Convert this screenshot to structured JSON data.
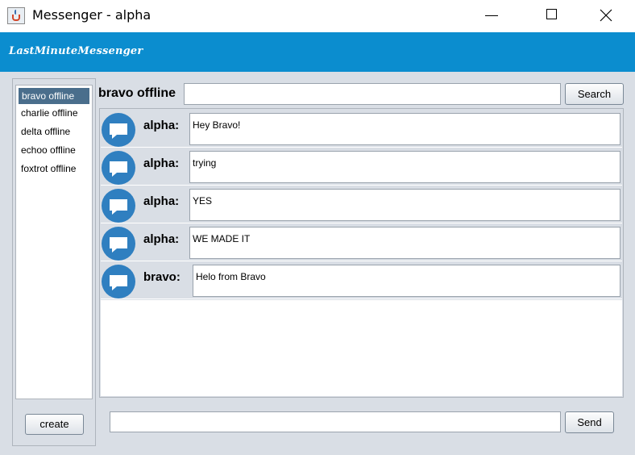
{
  "window": {
    "title": "Messenger - alpha"
  },
  "banner": {
    "brand": "LastMinuteMessenger"
  },
  "contacts": [
    {
      "label": "bravo offline",
      "selected": true
    },
    {
      "label": "charlie offline",
      "selected": false
    },
    {
      "label": "delta offline",
      "selected": false
    },
    {
      "label": "echoo offline",
      "selected": false
    },
    {
      "label": "foxtrot offline",
      "selected": false
    }
  ],
  "left_panel": {
    "create_label": "create"
  },
  "chat": {
    "header": "bravo offline",
    "search_label": "Search",
    "search_value": "",
    "messages": [
      {
        "author": "alpha:",
        "text": "Hey Bravo!"
      },
      {
        "author": "alpha:",
        "text": "trying"
      },
      {
        "author": "alpha:",
        "text": "YES"
      },
      {
        "author": "alpha:",
        "text": "WE MADE IT"
      },
      {
        "author": "bravo:",
        "text": "Helo from Bravo"
      }
    ],
    "compose_value": "",
    "send_label": "Send"
  },
  "colors": {
    "banner": "#0b8dcf",
    "panel_bg": "#d9dee5",
    "selected": "#4a6e8c",
    "chat_icon": "#2f7fc0"
  },
  "icons": {
    "app": "java-cup-icon",
    "message": "speech-bubble-icon"
  }
}
